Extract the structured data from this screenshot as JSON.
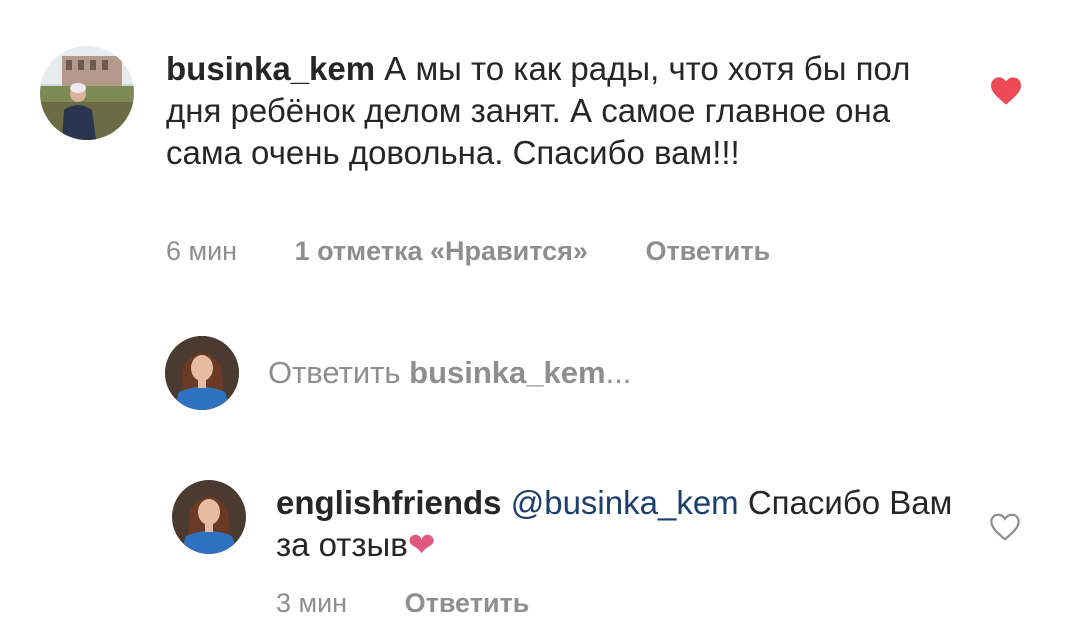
{
  "comment": {
    "username": "businka_kem",
    "text": "А мы то как рады, что хотя бы пол дня ребёнок делом занят. А самое главное она сама очень довольна. Спасибо вам!!!",
    "time": "6 мин",
    "likes": "1 отметка «Нравится»",
    "reply_label": "Ответить",
    "liked": true
  },
  "reply_box": {
    "prefix": "Ответить",
    "username": "businka_kem",
    "ellipsis": "..."
  },
  "reply": {
    "username": "englishfriends",
    "mention": "@businka_kem",
    "text": "Спасибо Вам за отзыв",
    "emoji": "❤",
    "time": "3 мин",
    "reply_label": "Ответить",
    "liked": false
  },
  "colors": {
    "like_red": "#ed4956",
    "emoji_pink": "#e0577f",
    "mention": "#1a3e6e",
    "meta_gray": "#8e8e8e"
  }
}
